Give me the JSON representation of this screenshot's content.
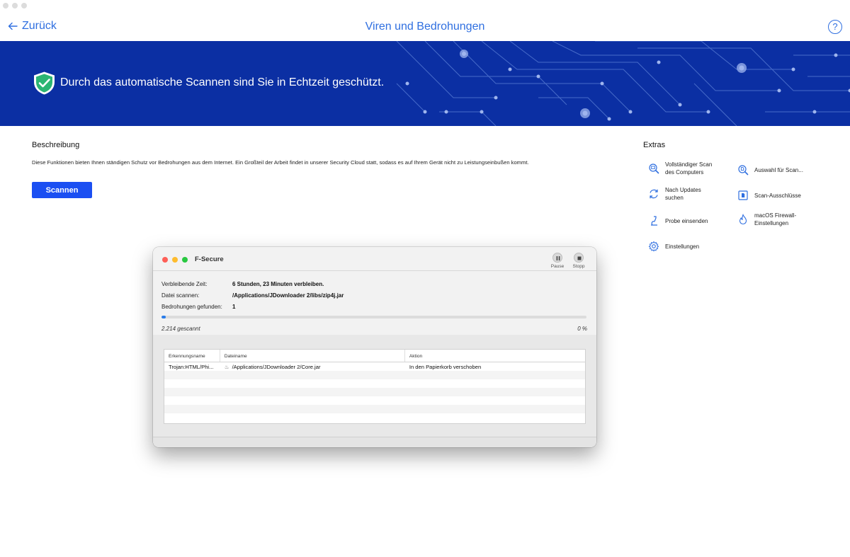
{
  "window": {
    "title": "Viren und Bedrohungen"
  },
  "header": {
    "back_label": "Zurück",
    "help_label": "?"
  },
  "banner": {
    "message": "Durch das automatische Scannen sind Sie in Echtzeit geschützt."
  },
  "description": {
    "title": "Beschreibung",
    "text": "Diese Funktionen bieten Ihnen ständigen Schutz vor Bedrohungen aus dem Internet. Ein Großteil der Arbeit findet in unserer Security Cloud statt, sodass es auf Ihrem Gerät nicht zu Leistungseinbußen kommt.",
    "scan_button": "Scannen"
  },
  "extras": {
    "title": "Extras",
    "items": [
      {
        "label_line1": "Vollständiger Scan",
        "label_line2": "des Computers",
        "icon": "magnifier-computer-icon"
      },
      {
        "label_line1": "Auswahl für Scan...",
        "label_line2": "",
        "icon": "magnifier-file-icon"
      },
      {
        "label_line1": "Nach Updates",
        "label_line2": "suchen",
        "icon": "refresh-icon"
      },
      {
        "label_line1": "Scan-Ausschlüsse",
        "label_line2": "",
        "icon": "excluded-file-icon"
      },
      {
        "label_line1": "Probe einsenden",
        "label_line2": "",
        "icon": "microscope-icon"
      },
      {
        "label_line1": "macOS Firewall-",
        "label_line2": "Einstellungen",
        "icon": "flame-icon"
      },
      {
        "label_line1": "Einstellungen",
        "label_line2": "",
        "icon": "gear-icon"
      }
    ]
  },
  "scan_dialog": {
    "title": "F-Secure",
    "pause_label": "Pause",
    "stop_label": "Stopp",
    "remaining_label": "Verbleibende Zeit:",
    "remaining_value": "6 Stunden, 23 Minuten verbleiben.",
    "file_label": "Datei scannen:",
    "file_value": "/Applications/JDownloader 2/libs/zip4j.jar",
    "threats_label": "Bedrohungen gefunden:",
    "threats_value": "1",
    "progress_fraction": 0.01,
    "scanned_text": "2.214 gescannt",
    "percent_text": "0 %",
    "columns": [
      "Erkennungsname",
      "Dateiname",
      "Aktion"
    ],
    "rows": [
      {
        "name": "Trojan:HTML/Phi...",
        "file": "/Applications/JDownloader 2/Core.jar",
        "action": "In den Papierkorb verschoben"
      }
    ]
  },
  "colors": {
    "accent": "#2f6fe0",
    "banner": "#0b2fa3",
    "button": "#1b4ff2",
    "progress": "#2b7de9"
  }
}
